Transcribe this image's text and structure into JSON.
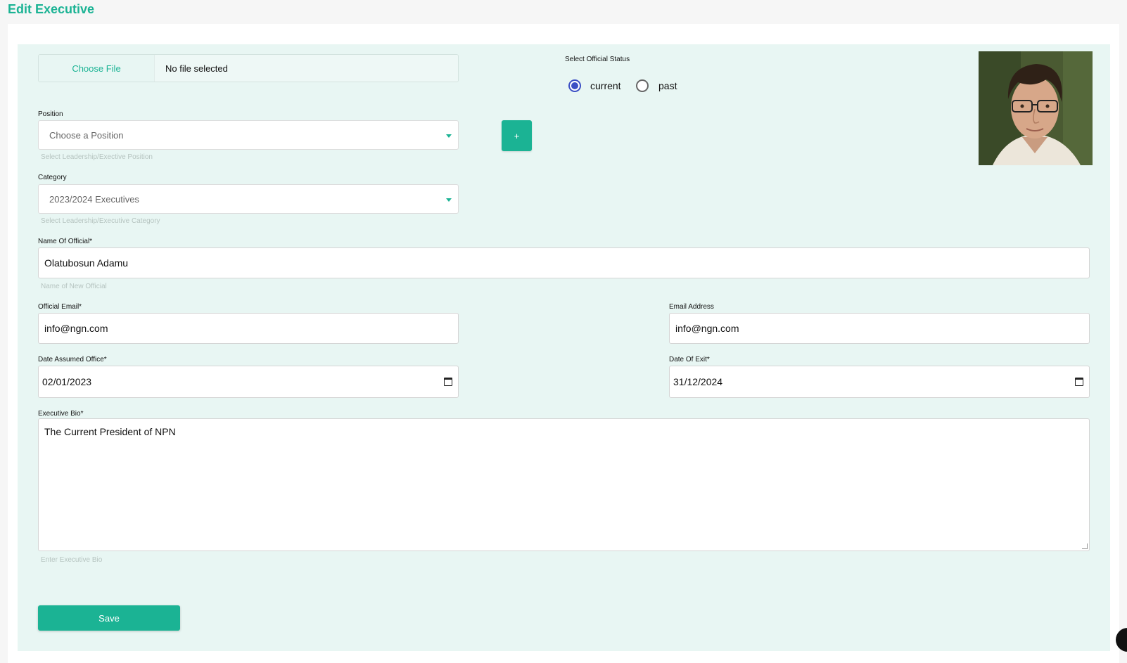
{
  "page": {
    "title": "Edit Executive"
  },
  "file_upload": {
    "button_label": "Choose File",
    "status": "No file selected"
  },
  "status": {
    "label": "Select Official Status",
    "options": [
      {
        "label": "current",
        "selected": true
      },
      {
        "label": "past",
        "selected": false
      }
    ]
  },
  "position": {
    "label": "Position",
    "placeholder": "Choose a Position",
    "hint": "Select Leadership/Exective Position",
    "add_button": "+"
  },
  "category": {
    "label": "Category",
    "value": "2023/2024 Executives",
    "hint": "Select Leadership/Executive Category"
  },
  "name": {
    "label": "Name Of Official*",
    "value": "Olatubosun Adamu",
    "hint": "Name of New Official"
  },
  "official_email": {
    "label": "Official Email*",
    "value": "info@ngn.com"
  },
  "email_address": {
    "label": "Email Address",
    "value": "info@ngn.com"
  },
  "date_assumed": {
    "label": "Date Assumed Office*",
    "value": "02/01/2023"
  },
  "date_exit": {
    "label": "Date Of Exit*",
    "value": "31/12/2024"
  },
  "bio": {
    "label": "Executive Bio*",
    "value": "The Current President of NPN",
    "hint": "Enter Executive Bio"
  },
  "save": {
    "label": "Save"
  },
  "colors": {
    "accent": "#1bb394",
    "panel": "#e8f6f3",
    "radio": "#3b4fc4"
  },
  "icons": [
    "dropdown-caret-icon",
    "calendar-icon",
    "chat-launcher-icon"
  ]
}
